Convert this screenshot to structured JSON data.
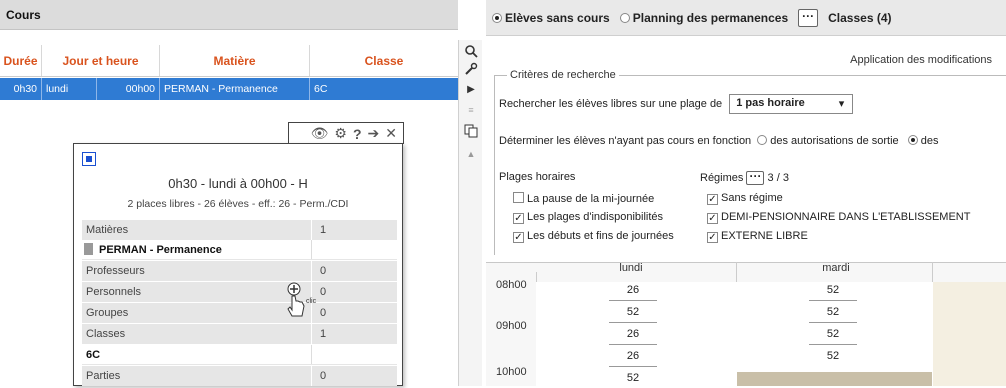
{
  "left": {
    "title": "Cours",
    "columns": [
      "Durée",
      "Jour et heure",
      "Matière",
      "Classe"
    ],
    "selected_row": {
      "duree": "0h30",
      "jour": "lundi",
      "heure": "00h00",
      "matiere": "PERMAN - Permanence",
      "classe": "6C"
    }
  },
  "popup": {
    "title": "0h30 - lundi à 00h00 - H",
    "subtitle": "2 places libres - 26 élèves - eff.: 26 - Perm./CDI",
    "rows": [
      {
        "label": "Matières",
        "value": "1"
      },
      {
        "label": "PERMAN - Permanence",
        "value": ""
      },
      {
        "label": "Professeurs",
        "value": "0"
      },
      {
        "label": "Personnels",
        "value": "0"
      },
      {
        "label": "Groupes",
        "value": "0"
      },
      {
        "label": "Classes",
        "value": "1"
      },
      {
        "label": "6C",
        "value": ""
      },
      {
        "label": "Parties",
        "value": "0"
      }
    ],
    "cursor_label": "clic"
  },
  "right": {
    "tabs": [
      {
        "label": "Elèves sans cours",
        "selected": true
      },
      {
        "label": "Planning des permanences",
        "selected": false
      }
    ],
    "classes_label": "Classes (4)",
    "apply_label": "Application des modifications",
    "criteria_title": "Critères de recherche",
    "search_prefix": "Rechercher les élèves libres sur une plage de",
    "search_value": "1 pas horaire",
    "determine_text": "Déterminer les élèves n'ayant pas cours en fonction",
    "determine_opt1": "des autorisations de sortie",
    "determine_opt2": "des",
    "plages_label": "Plages horaires",
    "regimes_label": "Régimes",
    "regimes_count": "3 / 3",
    "plages": [
      {
        "label": "La pause de la mi-journée",
        "checked": false
      },
      {
        "label": "Les plages d'indisponibilités",
        "checked": true
      },
      {
        "label": "Les débuts et fins de journées",
        "checked": true
      }
    ],
    "regimes": [
      {
        "label": "Sans régime",
        "checked": true
      },
      {
        "label": "DEMI-PENSIONNAIRE DANS L'ETABLISSEMENT",
        "checked": true
      },
      {
        "label": "EXTERNE LIBRE",
        "checked": true
      }
    ],
    "grid": {
      "days": [
        "lundi",
        "mardi"
      ],
      "times": [
        "08h00",
        "09h00",
        "10h00"
      ],
      "lundi": [
        "26",
        "52",
        "26",
        "26",
        "52"
      ],
      "mardi": [
        "52",
        "52",
        "52",
        "52"
      ]
    }
  }
}
